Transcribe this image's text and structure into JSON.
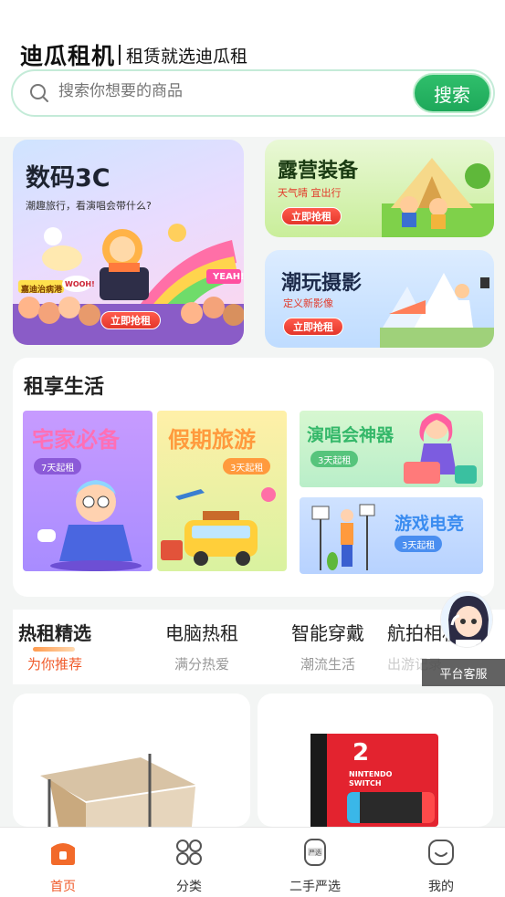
{
  "header": {
    "brand_name": "迪瓜租机",
    "slogan": "租赁就选迪瓜租",
    "search_placeholder": "搜索你想要的商品",
    "search_button": "搜索"
  },
  "banners": {
    "digital": {
      "title": "数码3C",
      "subtitle": "潮趣旅行，看演唱会带什么?",
      "cta": "立即抢租",
      "sign_left": "嘉迪治病港",
      "sign_right": "YEAH!",
      "bubble": "WOOH!"
    },
    "camping": {
      "title": "露营装备",
      "subtitle": "天气晴  宜出行",
      "cta": "立即抢租"
    },
    "photo": {
      "title": "潮玩摄影",
      "subtitle": "定义新影像",
      "cta": "立即抢租"
    }
  },
  "lifestyle": {
    "title": "租享生活",
    "tiles": [
      {
        "title": "宅家必备",
        "pill": "7天起租"
      },
      {
        "title": "假期旅游",
        "pill": "3天起租"
      },
      {
        "title": "演唱会神器",
        "pill": "3天起租"
      },
      {
        "title": "游戏电竞",
        "pill": "3天起租"
      }
    ]
  },
  "tabs": [
    {
      "label": "热租精选",
      "sub": "为你推荐"
    },
    {
      "label": "电脑热租",
      "sub": "满分热爱"
    },
    {
      "label": "智能穿戴",
      "sub": "潮流生活"
    },
    {
      "label": "航拍相机",
      "sub": "出游记录"
    }
  ],
  "customer_service": {
    "label": "平台客服"
  },
  "products": [
    {
      "name": "camping-tent"
    },
    {
      "name": "nintendo-switch",
      "box_text": "NINTENDO SWITCH",
      "box_number": "2"
    }
  ],
  "bottom_nav": [
    {
      "label": "首页",
      "icon": "home-icon"
    },
    {
      "label": "分类",
      "icon": "category-grid-icon"
    },
    {
      "label": "二手严选",
      "icon": "second-hand-icon",
      "badge": "严选"
    },
    {
      "label": "我的",
      "icon": "profile-icon"
    }
  ],
  "colors": {
    "accent_green": "#1ea85a",
    "accent_orange": "#f05a2a",
    "cta_red": "#e4362a"
  }
}
